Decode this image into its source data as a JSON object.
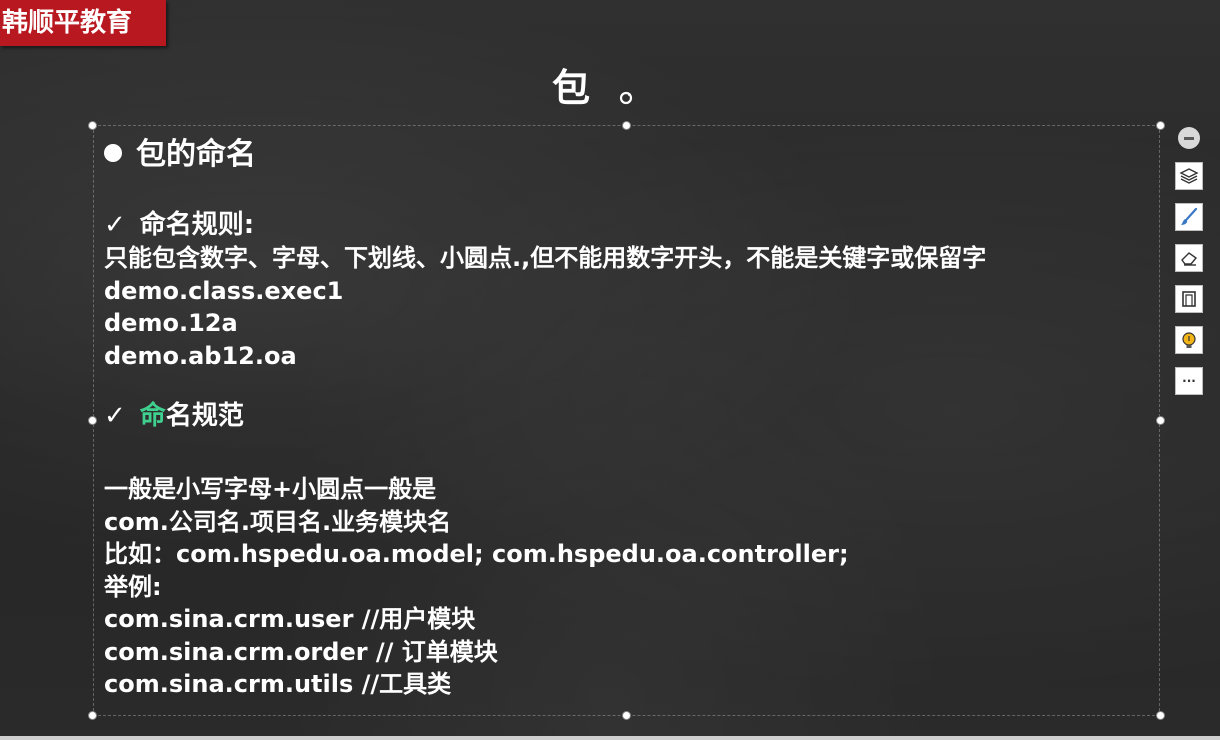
{
  "brand": {
    "label": "韩顺平教育",
    "color": "#b8181f"
  },
  "slide": {
    "title": "包",
    "heading": "包的命名",
    "rules_title": "命名规则:",
    "rules_lines": [
      "只能包含数字、字母、下划线、小圆点.,但不能用数字开头，不能是关键字或保留字",
      "demo.class.exec1",
      "demo.12a",
      "demo.ab12.oa"
    ],
    "conv_title_first_char": "命",
    "conv_title_rest": "名规范",
    "conv_lines": [
      "一般是小写字母+小圆点一般是",
      "com.公司名.项目名.业务模块名",
      "比如：com.hspedu.oa.model;  com.hspedu.oa.controller;",
      "举例:",
      "com.sina.crm.user  //用户模块",
      "com.sina.crm.order // 订单模块",
      "com.sina.crm.utils //工具类"
    ]
  },
  "symbols": {
    "check": "✓",
    "more": "···"
  },
  "toolbar": {
    "items": [
      "minus-icon",
      "layers-icon",
      "brush-icon",
      "eraser-icon",
      "crop-frame-icon",
      "lightbulb-icon",
      "more-icon"
    ]
  }
}
